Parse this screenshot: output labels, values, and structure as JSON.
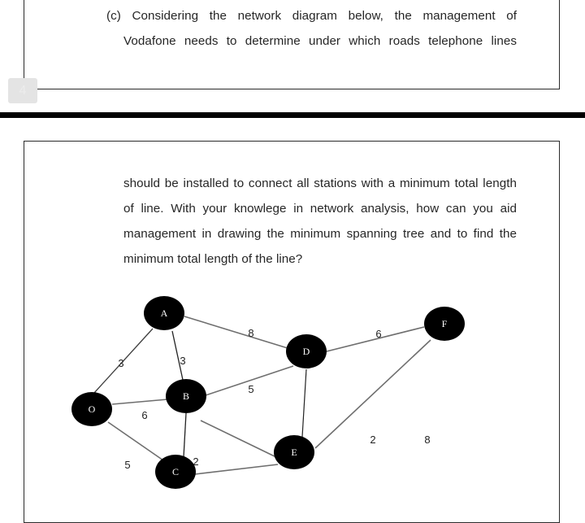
{
  "document": {
    "page_number": "4",
    "question_part": "(c)",
    "top_paragraph_lines": [
      "(c) Considering the network diagram below, the management of",
      "Vodafone needs to determine under which roads telephone lines"
    ],
    "bottom_paragraph_lines": [
      "should be installed to connect all stations with a minimum total length",
      "of line. With your knowlege in network analysis, how can you aid",
      "management in drawing the minimum spanning tree and to find the",
      "minimum total length of the line?"
    ]
  },
  "network": {
    "node_color": "#000000",
    "edge_color": "#6e6e6e",
    "nodes": [
      {
        "id": "O",
        "label": "O"
      },
      {
        "id": "A",
        "label": "A"
      },
      {
        "id": "B",
        "label": "B"
      },
      {
        "id": "C",
        "label": "C"
      },
      {
        "id": "D",
        "label": "D"
      },
      {
        "id": "E",
        "label": "E"
      },
      {
        "id": "F",
        "label": "F"
      }
    ],
    "edges": [
      {
        "from": "O",
        "to": "A",
        "weight": "3"
      },
      {
        "from": "A",
        "to": "B",
        "weight": "3"
      },
      {
        "from": "A",
        "to": "D",
        "weight": "8"
      },
      {
        "from": "B",
        "to": "D",
        "weight": "5"
      },
      {
        "from": "O",
        "to": "B",
        "weight": "6"
      },
      {
        "from": "O",
        "to": "C",
        "weight": "5"
      },
      {
        "from": "B",
        "to": "C",
        "weight": "2"
      },
      {
        "from": "B",
        "to": "E",
        "weight": ""
      },
      {
        "from": "C",
        "to": "E",
        "weight": ""
      },
      {
        "from": "D",
        "to": "E",
        "weight": ""
      },
      {
        "from": "D",
        "to": "F",
        "weight": "6"
      },
      {
        "from": "E",
        "to": "F",
        "weight": ""
      }
    ],
    "floating_labels": [
      "2",
      "8"
    ]
  }
}
